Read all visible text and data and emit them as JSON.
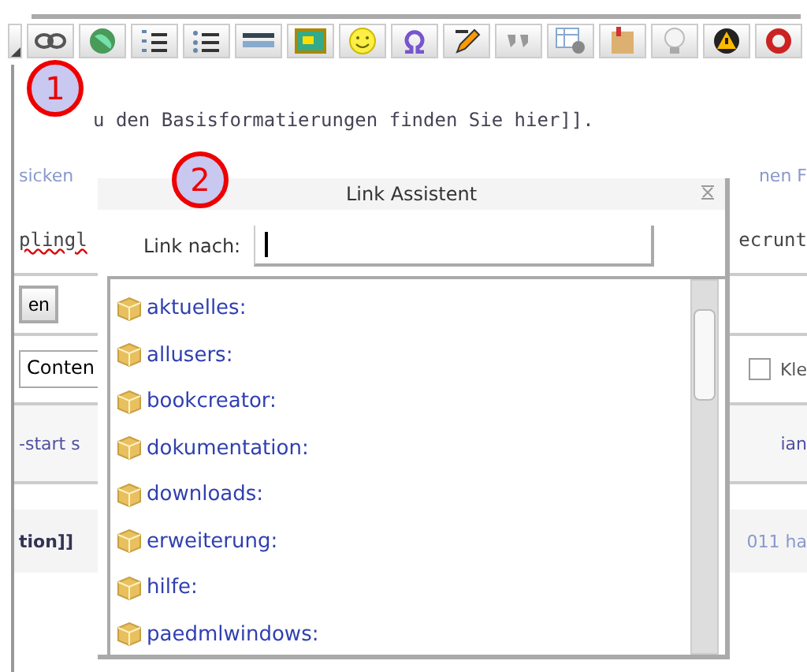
{
  "editor": {
    "text_line": "u den Basisformatierungen finden Sie hier]].",
    "rows": [
      {
        "kind": "text",
        "left": "sicken",
        "right": "nen F"
      },
      {
        "kind": "spell",
        "left": "plingl",
        "right": "ecrunt"
      },
      {
        "kind": "button",
        "left": "en"
      },
      {
        "kind": "field",
        "left": "Conten",
        "right": "Kle",
        "checked": false
      },
      {
        "kind": "tab",
        "left": "-start s",
        "right": "ian"
      },
      {
        "kind": "footer",
        "left": "tion]]",
        "right": "011 ha"
      }
    ]
  },
  "markers": [
    {
      "number": "1"
    },
    {
      "number": "2"
    }
  ],
  "link_assistant": {
    "title": "Link Assistent",
    "label": "Link nach:",
    "items": [
      {
        "label": "aktuelles:"
      },
      {
        "label": "allusers:"
      },
      {
        "label": "bookcreator:"
      },
      {
        "label": "dokumentation:"
      },
      {
        "label": "downloads:"
      },
      {
        "label": "erweiterung:"
      },
      {
        "label": "hilfe:"
      },
      {
        "label": "paedmlwindows:"
      }
    ]
  }
}
